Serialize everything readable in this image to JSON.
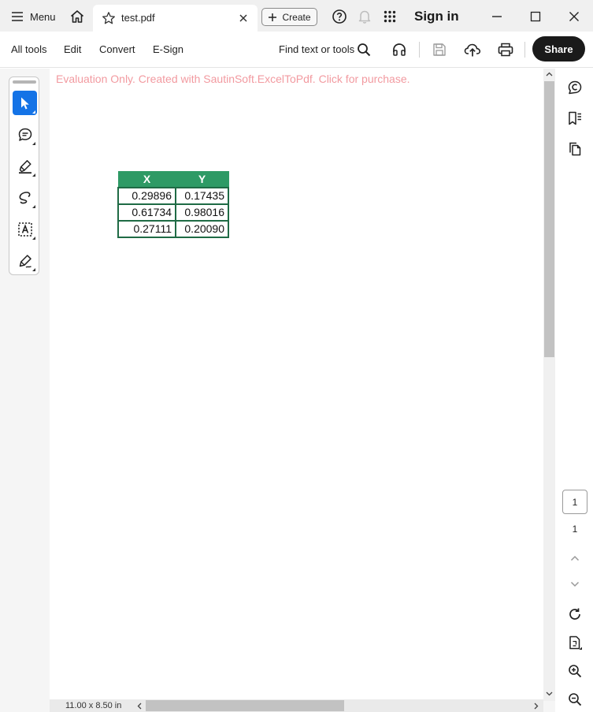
{
  "titlebar": {
    "menu_label": "Menu",
    "tab_title": "test.pdf",
    "create_label": "Create",
    "sign_in_label": "Sign in"
  },
  "toolbar": {
    "items": [
      "All tools",
      "Edit",
      "Convert",
      "E-Sign"
    ],
    "find_label": "Find text or tools",
    "share_label": "Share"
  },
  "document": {
    "watermark": "Evaluation Only. Created with SautinSoft.ExcelToPdf. Click for purchase.",
    "table": {
      "headers": [
        "X",
        "Y"
      ],
      "rows": [
        [
          "0.29896",
          "0.17435"
        ],
        [
          "0.61734",
          "0.98016"
        ],
        [
          "0.27111",
          "0.20090"
        ]
      ]
    }
  },
  "status": {
    "page_size": "11.00 x 8.50 in"
  },
  "pagination": {
    "current_page": "1",
    "total_pages": "1"
  },
  "colors": {
    "accent": "#1473e6",
    "table_header": "#2e9a65",
    "table_border": "#1f6b45",
    "watermark": "#f29aa0",
    "share_button": "#1a1a1a"
  },
  "icons": {
    "titlebar": [
      "hamburger-menu-icon",
      "home-icon",
      "star-icon",
      "close-tab-icon",
      "plus-icon",
      "help-icon",
      "bell-icon",
      "apps-grid-icon",
      "minimize-icon",
      "maximize-icon",
      "close-window-icon"
    ],
    "toolbar": [
      "search-icon",
      "headphones-icon",
      "save-icon",
      "cloud-upload-icon",
      "print-icon"
    ],
    "left_rail": [
      "select-cursor-icon",
      "comment-icon",
      "highlighter-icon",
      "draw-freeform-icon",
      "text-box-icon",
      "sign-pen-icon"
    ],
    "right_rail": [
      "ai-assistant-icon",
      "bookmarks-icon",
      "page-thumbnails-icon",
      "chevron-up-icon",
      "chevron-down-icon",
      "refresh-icon",
      "page-fit-icon",
      "zoom-in-icon",
      "zoom-out-icon"
    ]
  }
}
